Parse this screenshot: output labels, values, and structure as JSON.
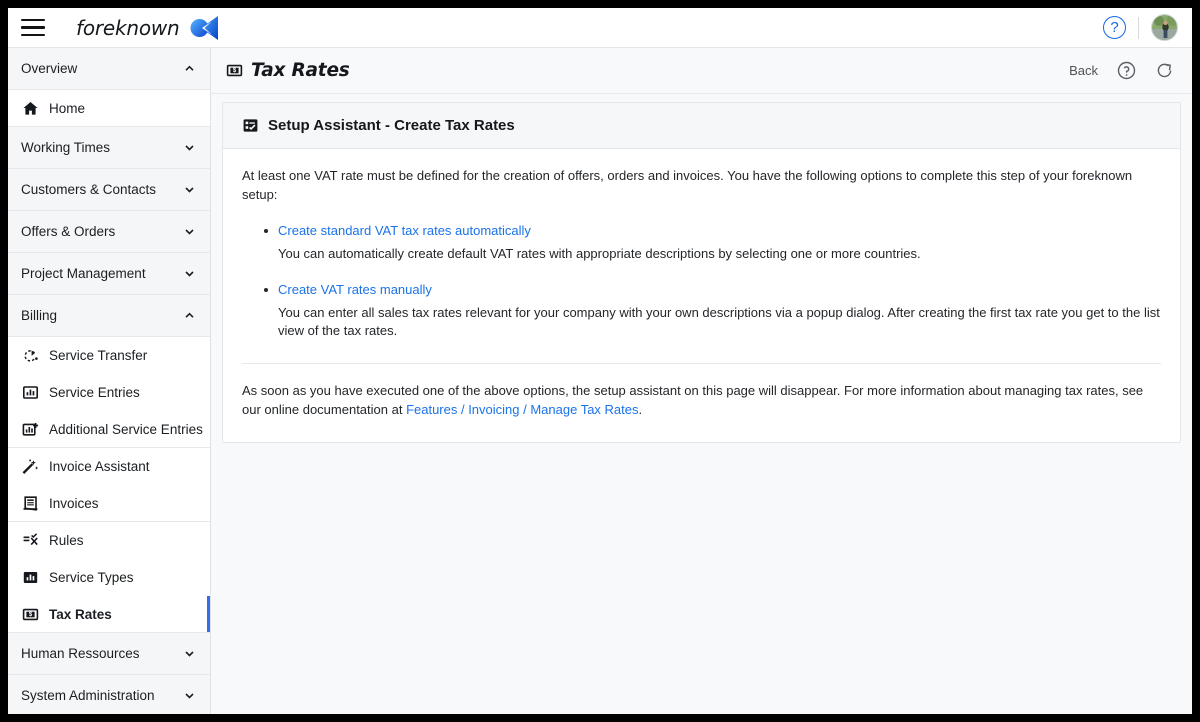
{
  "topbar": {
    "menu_icon": "hamburger-icon",
    "brand_name": "foreknown",
    "brand_logo_icon": "foreknown-logo-icon",
    "help_icon": "help-circle-icon",
    "help_glyph": "?",
    "avatar_icon": "user-avatar",
    "accent_color": "#1268e3"
  },
  "sidebar": {
    "items": [
      {
        "label": "Overview",
        "type": "section",
        "icon": "chevron-up-icon",
        "expanded": true
      },
      {
        "label": "Home",
        "type": "item",
        "icon": "home-icon",
        "selected": false
      },
      {
        "label": "Working Times",
        "type": "section",
        "icon": "chevron-down-icon",
        "expanded": false
      },
      {
        "label": "Customers & Contacts",
        "type": "section",
        "icon": "chevron-down-icon",
        "expanded": false
      },
      {
        "label": "Offers & Orders",
        "type": "section",
        "icon": "chevron-down-icon",
        "expanded": false
      },
      {
        "label": "Project Management",
        "type": "section",
        "icon": "chevron-down-icon",
        "expanded": false
      },
      {
        "label": "Billing",
        "type": "section",
        "icon": "chevron-up-icon",
        "expanded": true
      },
      {
        "label": "Service Transfer",
        "type": "item",
        "icon": "service-transfer-icon",
        "selected": false
      },
      {
        "label": "Service Entries",
        "type": "item",
        "icon": "chart-bars-icon",
        "selected": false
      },
      {
        "label": "Additional Service Entries",
        "type": "item",
        "icon": "chart-bars-plus-icon",
        "selected": false
      },
      {
        "label": "Invoice Assistant",
        "type": "item",
        "icon": "magic-wand-icon",
        "selected": false
      },
      {
        "label": "Invoices",
        "type": "item",
        "icon": "invoice-icon",
        "selected": false
      },
      {
        "label": "Rules",
        "type": "item",
        "icon": "rules-icon",
        "selected": false
      },
      {
        "label": "Service Types",
        "type": "item",
        "icon": "chart-bars-icon",
        "selected": false
      },
      {
        "label": "Tax Rates",
        "type": "item",
        "icon": "money-note-icon",
        "selected": true
      },
      {
        "label": "Human Ressources",
        "type": "section",
        "icon": "chevron-down-icon",
        "expanded": false
      },
      {
        "label": "System Administration",
        "type": "section",
        "icon": "chevron-down-icon",
        "expanded": false
      }
    ],
    "selected_indicator_color": "#2f6fed"
  },
  "page": {
    "title": "Tax Rates",
    "title_icon": "money-note-icon",
    "back_label": "Back",
    "help_icon": "help-circle-icon",
    "refresh_icon": "refresh-icon"
  },
  "card": {
    "header_icon": "checklist-icon",
    "header_title": "Setup Assistant - Create Tax Rates",
    "intro": "At least one VAT rate must be defined for the creation of offers, orders and invoices. You have the following options to complete this step of your foreknown setup:",
    "options": [
      {
        "link": "Create standard VAT tax rates automatically",
        "description": "You can automatically create default VAT rates with appropriate descriptions by selecting one or more countries."
      },
      {
        "link": "Create VAT rates manually",
        "description": "You can enter all sales tax rates relevant for your company with your own descriptions via a popup dialog. After creating the first tax rate you get to the list view of the tax rates."
      }
    ],
    "outro_before": "As soon as you have executed one of the above options, the setup assistant on this page will disappear. For more information about managing tax rates, see our online documentation at ",
    "outro_link": "Features / Invoicing / Manage Tax Rates",
    "outro_after": ".",
    "link_color": "#1a73e8"
  }
}
